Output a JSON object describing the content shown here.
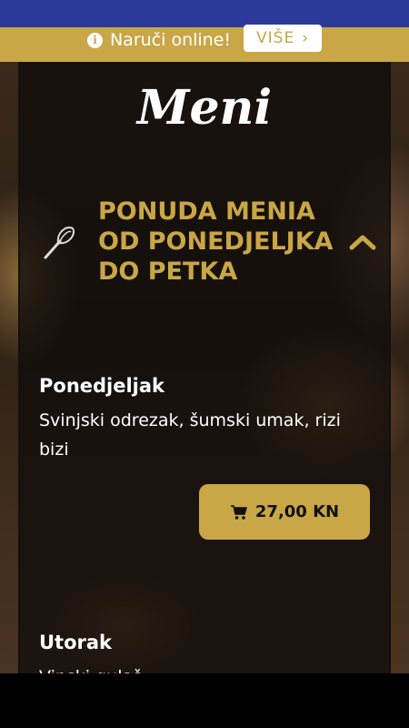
{
  "notice": {
    "text": "Naruči online!",
    "button_label": "VIŠE",
    "chevron": "›"
  },
  "header": {
    "title": "Meni"
  },
  "section": {
    "title": "PONUDA MENIA OD PONEDJELJKA DO PETKA",
    "icon": "whisk-icon",
    "toggle_icon": "chevron-up-icon"
  },
  "days": [
    {
      "name": "Ponedjeljak",
      "description": "Svinjski odrezak, šumski umak, rizi bizi",
      "price": "27,00 KN"
    },
    {
      "name": "Utorak",
      "description": "Vinski gulaš"
    }
  ],
  "colors": {
    "accent": "#c9a646",
    "status_bar": "#2b3a9a"
  }
}
